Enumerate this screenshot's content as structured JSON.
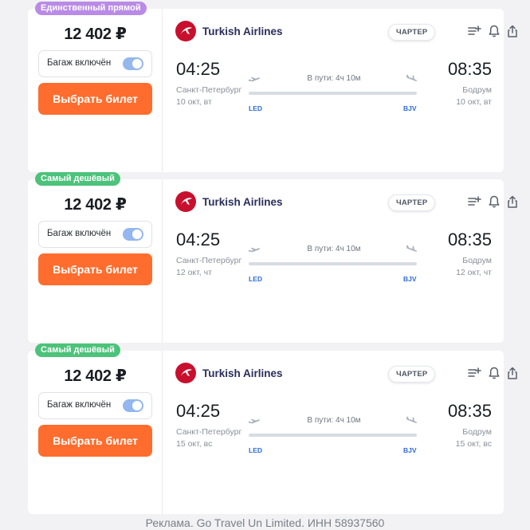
{
  "colors": {
    "badge_direct": "#b98be6",
    "badge_cheapest": "#4cc27a",
    "button": "#ff6d2e",
    "toggle_on": "#93b7ee",
    "iata": "#2d6bd6",
    "airline_logo": "#c8102e"
  },
  "icons": {
    "airline_logo": "turkish-airlines-logo",
    "add_to_list": "list-plus-icon",
    "subscribe": "bell-icon",
    "share": "share-icon",
    "departure": "plane-takeoff-icon",
    "arrival": "plane-landing-icon"
  },
  "tickets": [
    {
      "badge": "Единственный прямой",
      "badge_type": "direct",
      "price": "12 402 ₽",
      "baggage_label": "Багаж включён",
      "baggage_included": true,
      "select_label": "Выбрать билет",
      "airline": "Turkish Airlines",
      "charter": "ЧАРТЕР",
      "departure_time": "04:25",
      "arrival_time": "08:35",
      "duration": "В пути: 4ч 10м",
      "departure_city": "Санкт-Петербург",
      "departure_date": "10 окт, вт",
      "arrival_city": "Бодрум",
      "arrival_date": "10 окт, вт",
      "departure_iata": "LED",
      "arrival_iata": "BJV"
    },
    {
      "badge": "Самый дешёвый",
      "badge_type": "cheapest",
      "price": "12 402 ₽",
      "baggage_label": "Багаж включён",
      "baggage_included": true,
      "select_label": "Выбрать билет",
      "airline": "Turkish Airlines",
      "charter": "ЧАРТЕР",
      "departure_time": "04:25",
      "arrival_time": "08:35",
      "duration": "В пути: 4ч 10м",
      "departure_city": "Санкт-Петербург",
      "departure_date": "12 окт, чт",
      "arrival_city": "Бодрум",
      "arrival_date": "12 окт, чт",
      "departure_iata": "LED",
      "arrival_iata": "BJV"
    },
    {
      "badge": "Самый дешёвый",
      "badge_type": "cheapest",
      "price": "12 402 ₽",
      "baggage_label": "Багаж включён",
      "baggage_included": true,
      "select_label": "Выбрать билет",
      "airline": "Turkish Airlines",
      "charter": "ЧАРТЕР",
      "departure_time": "04:25",
      "arrival_time": "08:35",
      "duration": "В пути: 4ч 10м",
      "departure_city": "Санкт-Петербург",
      "departure_date": "15 окт, вс",
      "arrival_city": "Бодрум",
      "arrival_date": "15 окт, вс",
      "departure_iata": "LED",
      "arrival_iata": "BJV"
    }
  ],
  "footer": "Реклама. Go Travel Un Limited. ИНН 58937560"
}
